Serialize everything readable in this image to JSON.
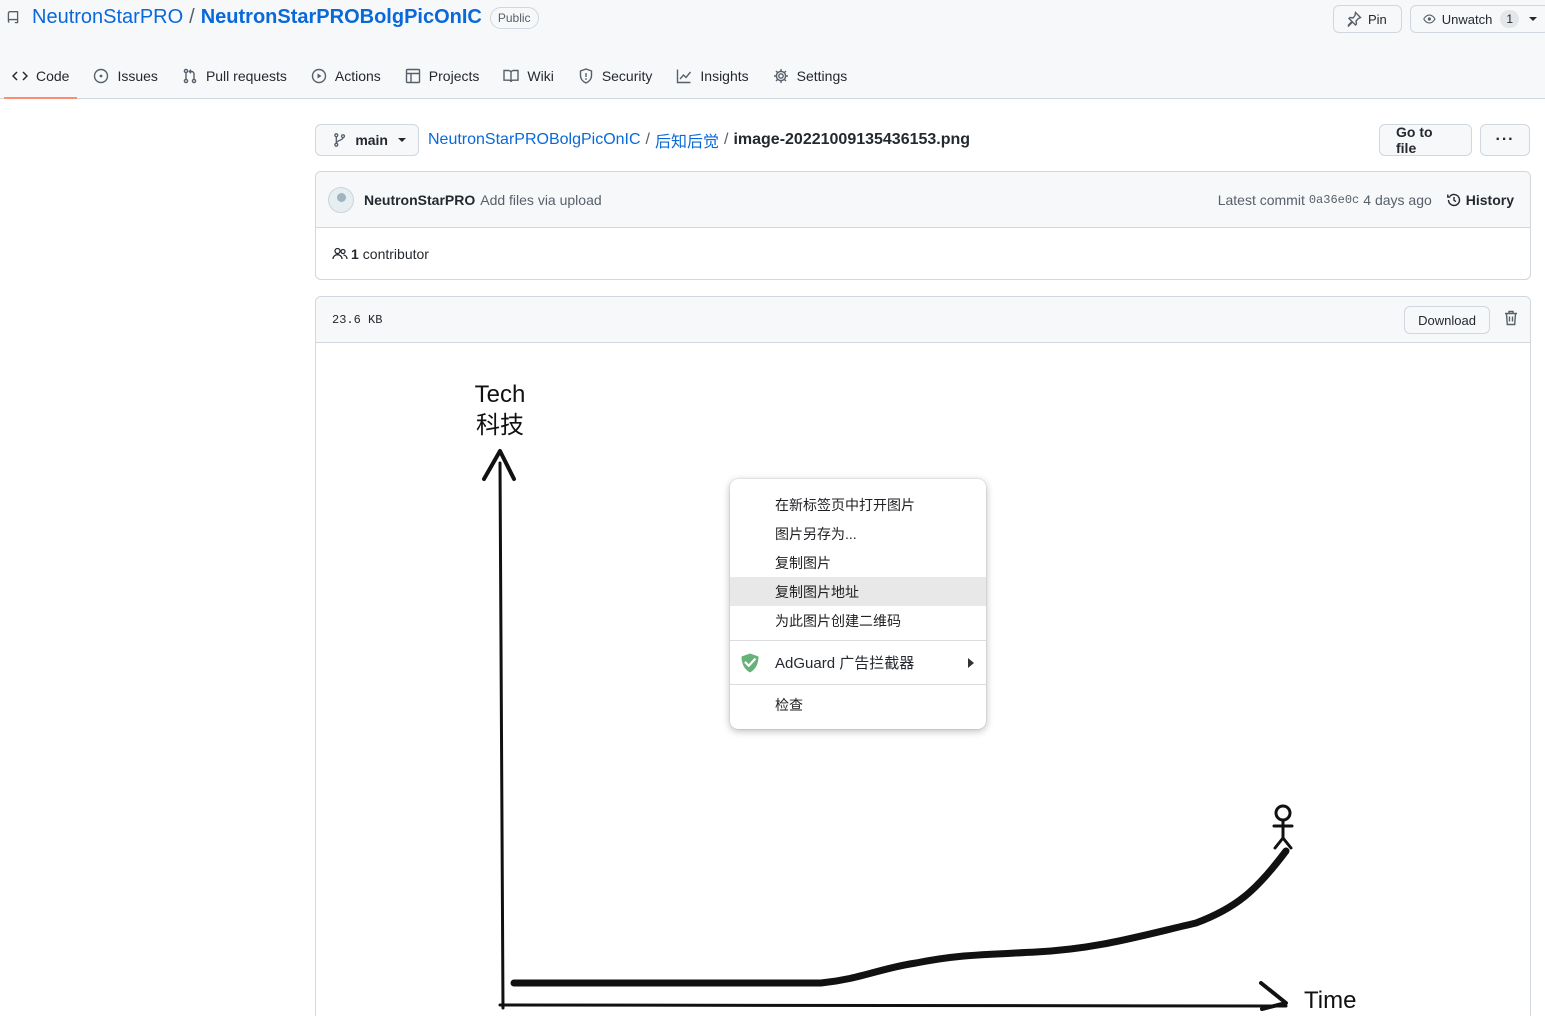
{
  "repo": {
    "owner": "NeutronStarPRO",
    "name": "NeutronStarPROBolgPicOnIC",
    "visibility": "Public",
    "pin_label": "Pin",
    "unwatch_label": "Unwatch",
    "watch_count": "1"
  },
  "tabs": [
    {
      "label": "Code",
      "icon": "code-icon"
    },
    {
      "label": "Issues",
      "icon": "issue-icon"
    },
    {
      "label": "Pull requests",
      "icon": "pull-request-icon"
    },
    {
      "label": "Actions",
      "icon": "play-icon"
    },
    {
      "label": "Projects",
      "icon": "table-icon"
    },
    {
      "label": "Wiki",
      "icon": "book-icon"
    },
    {
      "label": "Security",
      "icon": "shield-icon"
    },
    {
      "label": "Insights",
      "icon": "graph-icon"
    },
    {
      "label": "Settings",
      "icon": "gear-icon"
    }
  ],
  "branch": "main",
  "breadcrumb": {
    "repo": "NeutronStarPROBolgPicOnIC",
    "folder": "后知后觉",
    "file": "image-20221009135436153.png",
    "sep": "/"
  },
  "goto_label": "Go to file",
  "more_label": "···",
  "commit": {
    "author": "NeutronStarPRO",
    "message": "Add files via upload",
    "latest_label": "Latest commit",
    "sha": "0a36e0c",
    "time": "4 days ago",
    "history_label": "History"
  },
  "contributors": {
    "count": "1",
    "label": "contributor"
  },
  "file": {
    "size": "23.6 KB",
    "download_label": "Download"
  },
  "image_text": {
    "y_label_en": "Tech",
    "y_label_zh": "科技",
    "x_label": "Time"
  },
  "context_menu": {
    "items": [
      "在新标签页中打开图片",
      "图片另存为...",
      "复制图片",
      "复制图片地址",
      "为此图片创建二维码"
    ],
    "adguard": "AdGuard 广告拦截器",
    "inspect": "检查"
  },
  "colors": {
    "link": "#0969da",
    "tab_underline": "#fd8c73",
    "adguard_green": "#67b279"
  }
}
